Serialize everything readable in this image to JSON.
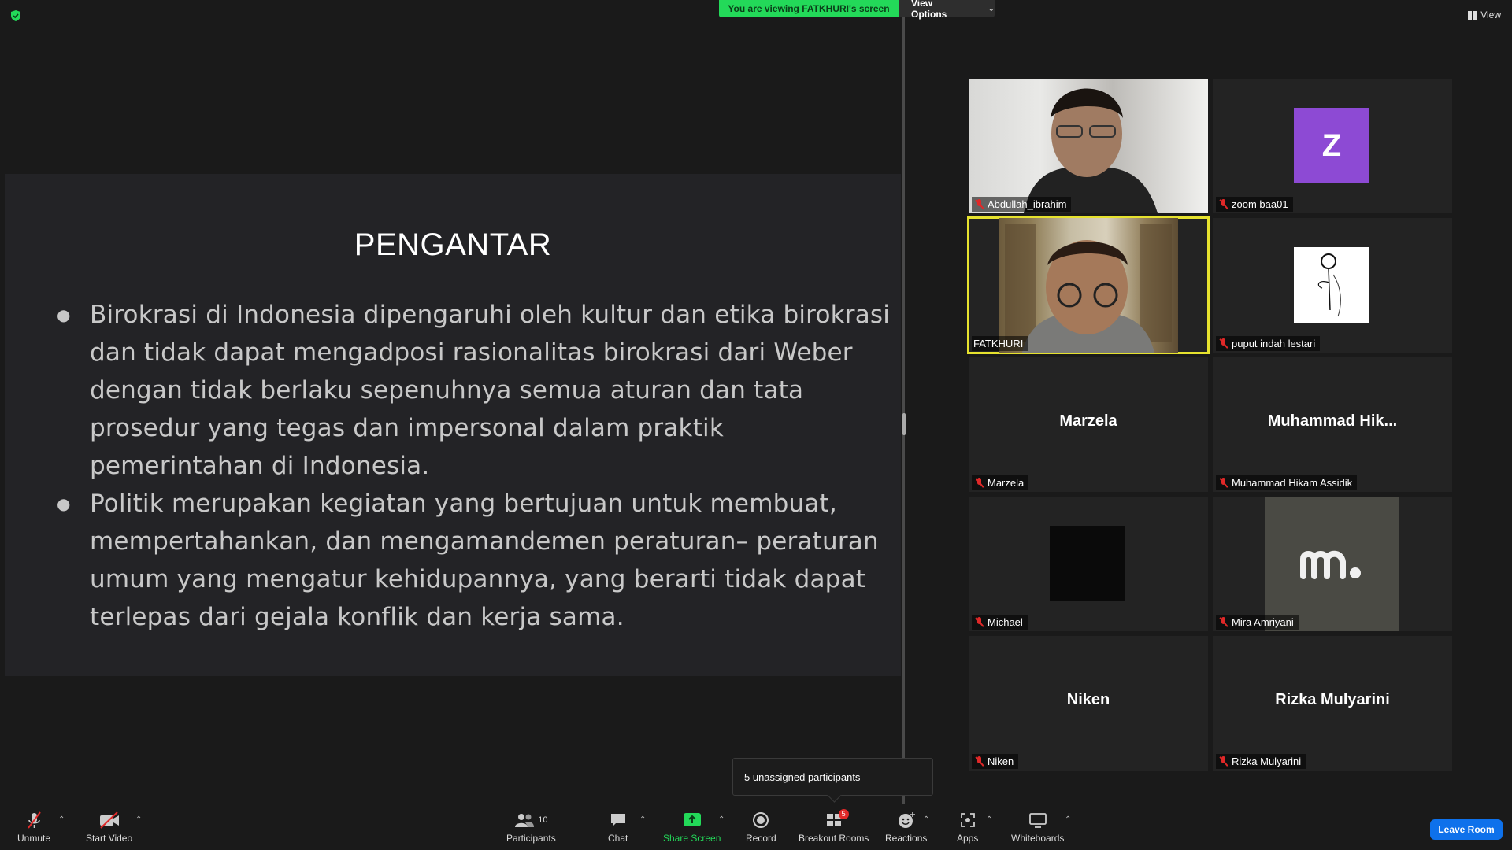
{
  "top": {
    "banner": "You are viewing FATKHURI's screen",
    "view_options": "View Options",
    "view": "View"
  },
  "slide": {
    "title": "PENGANTAR",
    "bullets": [
      "Birokrasi di Indonesia dipengaruhi oleh kultur dan etika birokrasi dan tidak dapat mengadposi rasionalitas birokrasi dari Weber dengan tidak berlaku sepenuhnya semua aturan dan tata prosedur yang tegas dan impersonal dalam praktik pemerintahan di Indonesia.",
      "Politik merupakan kegiatan yang bertujuan untuk membuat, mempertahankan, dan mengamandemen peraturan– peraturan umum yang mengatur kehidupannya, yang berarti tidak dapat terlepas dari gejala konflik dan kerja sama."
    ]
  },
  "participants": [
    {
      "name": "Abdullah_ibrahim",
      "muted": true
    },
    {
      "name": "zoom baa01",
      "muted": true,
      "avatar_letter": "Z"
    },
    {
      "name": "FATKHURI",
      "muted": false
    },
    {
      "name": "puput indah lestari",
      "muted": true
    },
    {
      "name": "Marzela",
      "muted": true,
      "display": "Marzela"
    },
    {
      "name": "Muhammad Hikam Assidik",
      "muted": true,
      "display": "Muhammad  Hik..."
    },
    {
      "name": "Michael",
      "muted": true
    },
    {
      "name": "Mira Amriyani",
      "muted": true
    },
    {
      "name": "Niken",
      "muted": true,
      "display": "Niken"
    },
    {
      "name": "Rizka Mulyarini",
      "muted": true,
      "display": "Rizka Mulyarini"
    }
  ],
  "tooltip": "5 unassigned participants",
  "toolbar": {
    "unmute": "Unmute",
    "start_video": "Start Video",
    "participants": "Participants",
    "participants_count": "10",
    "chat": "Chat",
    "share_screen": "Share Screen",
    "record": "Record",
    "breakout_rooms": "Breakout Rooms",
    "breakout_badge": "5",
    "reactions": "Reactions",
    "apps": "Apps",
    "whiteboards": "Whiteboards",
    "leave": "Leave Room"
  },
  "colors": {
    "banner_green": "#23d959",
    "active_speaker": "#e6e22e",
    "leave_blue": "#0e71eb",
    "muted_red": "#e02828",
    "avatar_purple": "#8d4ad4"
  }
}
